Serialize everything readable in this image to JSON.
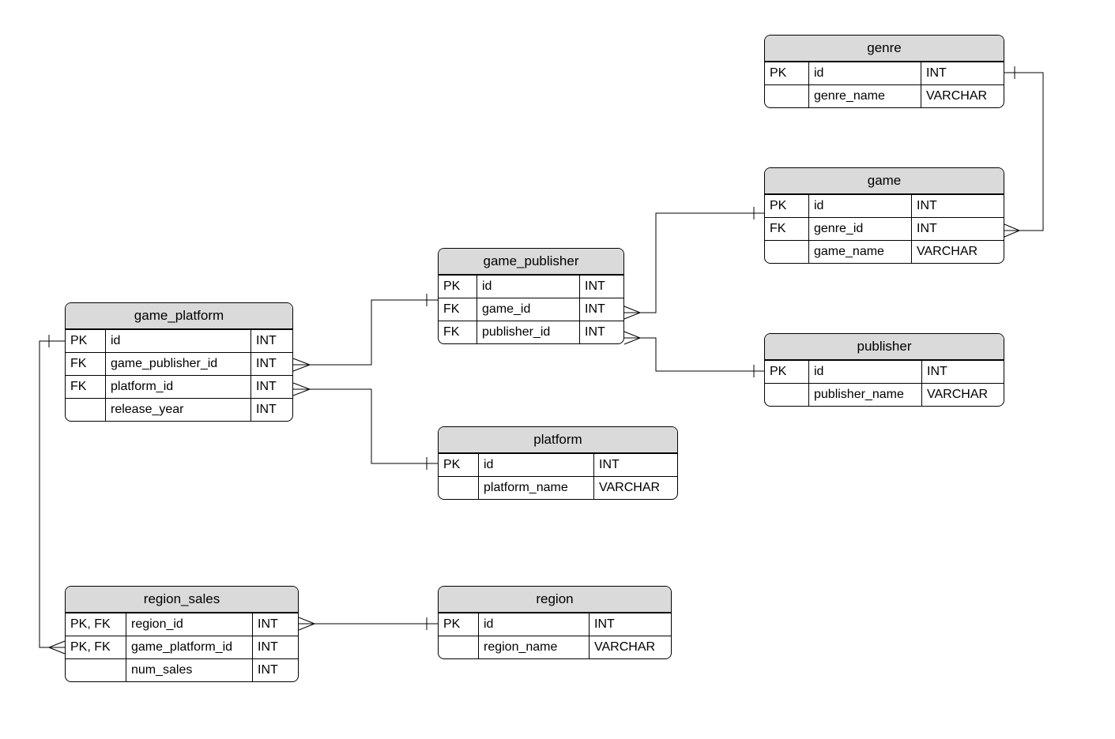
{
  "entities": {
    "genre": {
      "title": "genre",
      "cols": [
        {
          "k": "PK",
          "n": "id",
          "t": "INT"
        },
        {
          "k": "",
          "n": "genre_name",
          "t": "VARCHAR"
        }
      ]
    },
    "game": {
      "title": "game",
      "cols": [
        {
          "k": "PK",
          "n": "id",
          "t": "INT"
        },
        {
          "k": "FK",
          "n": "genre_id",
          "t": "INT"
        },
        {
          "k": "",
          "n": "game_name",
          "t": "VARCHAR"
        }
      ]
    },
    "publisher": {
      "title": "publisher",
      "cols": [
        {
          "k": "PK",
          "n": "id",
          "t": "INT"
        },
        {
          "k": "",
          "n": "publisher_name",
          "t": "VARCHAR"
        }
      ]
    },
    "game_publisher": {
      "title": "game_publisher",
      "cols": [
        {
          "k": "PK",
          "n": "id",
          "t": "INT"
        },
        {
          "k": "FK",
          "n": "game_id",
          "t": "INT"
        },
        {
          "k": "FK",
          "n": "publisher_id",
          "t": "INT"
        }
      ]
    },
    "platform": {
      "title": "platform",
      "cols": [
        {
          "k": "PK",
          "n": "id",
          "t": "INT"
        },
        {
          "k": "",
          "n": "platform_name",
          "t": "VARCHAR"
        }
      ]
    },
    "game_platform": {
      "title": "game_platform",
      "cols": [
        {
          "k": "PK",
          "n": "id",
          "t": "INT"
        },
        {
          "k": "FK",
          "n": "game_publisher_id",
          "t": "INT"
        },
        {
          "k": "FK",
          "n": "platform_id",
          "t": "INT"
        },
        {
          "k": "",
          "n": "release_year",
          "t": "INT"
        }
      ]
    },
    "region": {
      "title": "region",
      "cols": [
        {
          "k": "PK",
          "n": "id",
          "t": "INT"
        },
        {
          "k": "",
          "n": "region_name",
          "t": "VARCHAR"
        }
      ]
    },
    "region_sales": {
      "title": "region_sales",
      "cols": [
        {
          "k": "PK, FK",
          "n": "region_id",
          "t": "INT"
        },
        {
          "k": "PK, FK",
          "n": "game_platform_id",
          "t": "INT"
        },
        {
          "k": "",
          "n": "num_sales",
          "t": "INT"
        }
      ]
    }
  },
  "relationships": [
    {
      "from": "game.genre_id",
      "to": "genre.id",
      "type": "many-to-one"
    },
    {
      "from": "game_publisher.game_id",
      "to": "game.id",
      "type": "many-to-one"
    },
    {
      "from": "game_publisher.publisher_id",
      "to": "publisher.id",
      "type": "many-to-one"
    },
    {
      "from": "game_platform.game_publisher_id",
      "to": "game_publisher.id",
      "type": "many-to-one"
    },
    {
      "from": "game_platform.platform_id",
      "to": "platform.id",
      "type": "many-to-one"
    },
    {
      "from": "region_sales.region_id",
      "to": "region.id",
      "type": "many-to-one"
    },
    {
      "from": "region_sales.game_platform_id",
      "to": "game_platform.id",
      "type": "many-to-one"
    }
  ]
}
